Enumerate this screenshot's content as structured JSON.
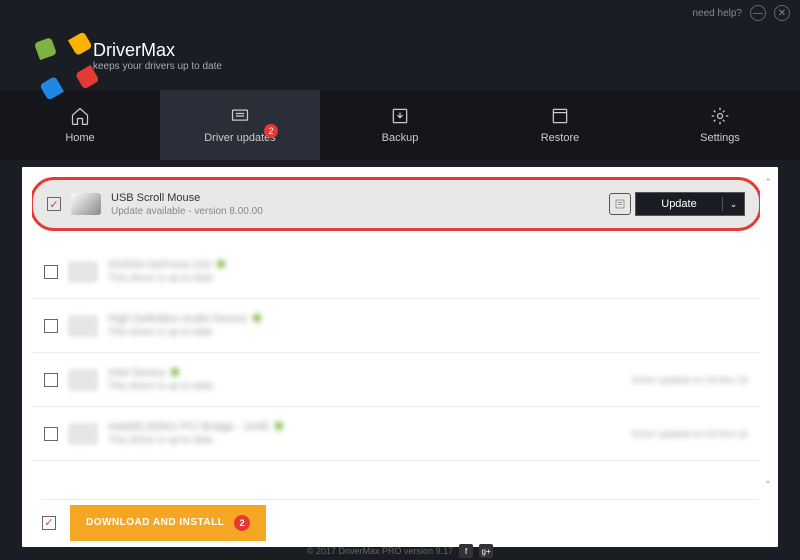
{
  "titlebar": {
    "help": "need help?"
  },
  "header": {
    "title": "DriverMax",
    "subtitle": "keeps your drivers up to date"
  },
  "nav": {
    "items": [
      {
        "label": "Home"
      },
      {
        "label": "Driver updates",
        "badge": "2"
      },
      {
        "label": "Backup"
      },
      {
        "label": "Restore"
      },
      {
        "label": "Settings"
      }
    ]
  },
  "drivers": {
    "highlighted": {
      "name": "USB Scroll Mouse",
      "status": "Update available - version 8.00.00",
      "button": "Update"
    },
    "rows": [
      {
        "name": "NVIDIA GeForce 210",
        "status": "This driver is up-to-date"
      },
      {
        "name": "High Definition Audio Device",
        "status": "This driver is up-to-date"
      },
      {
        "name": "Intel Device",
        "status": "This driver is up-to-date",
        "right": "Driver updated on 03-Nov-16"
      },
      {
        "name": "Intel(R) 82801 PCI Bridge - 244E",
        "status": "This driver is up-to-date",
        "right": "Driver updated on 03-Nov-16"
      }
    ]
  },
  "bottom": {
    "install": "DOWNLOAD AND INSTALL",
    "badge": "2"
  },
  "footer": {
    "copyright": "© 2017 DriverMax PRO version 9.17"
  }
}
